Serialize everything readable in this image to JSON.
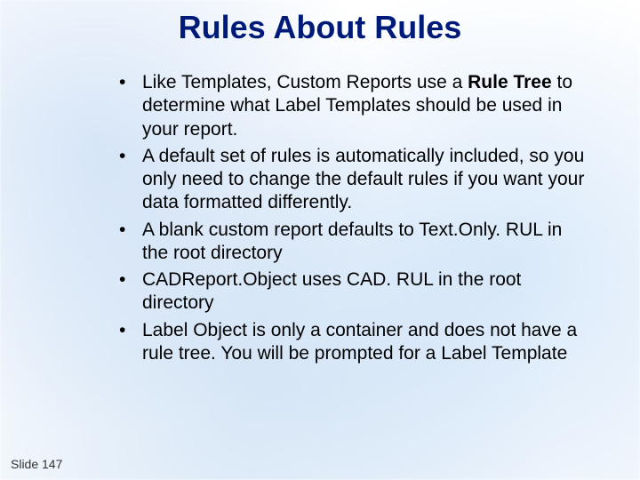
{
  "title": "Rules About Rules",
  "bullets": {
    "b1_pre": "Like Templates, Custom Reports use a ",
    "b1_bold": "Rule Tree",
    "b1_post": " to determine what Label Templates should be used in your report.",
    "b2": "A default set of rules is automatically included, so you only need to change the default rules if you want your data formatted differently.",
    "b3": "A blank custom report defaults to Text.Only. RUL in the root directory",
    "b4": "CADReport.Object uses CAD. RUL in the root directory",
    "b5": "Label Object is only a container and does not have a rule tree. You will be prompted for a Label Template"
  },
  "footer": "Slide 147"
}
